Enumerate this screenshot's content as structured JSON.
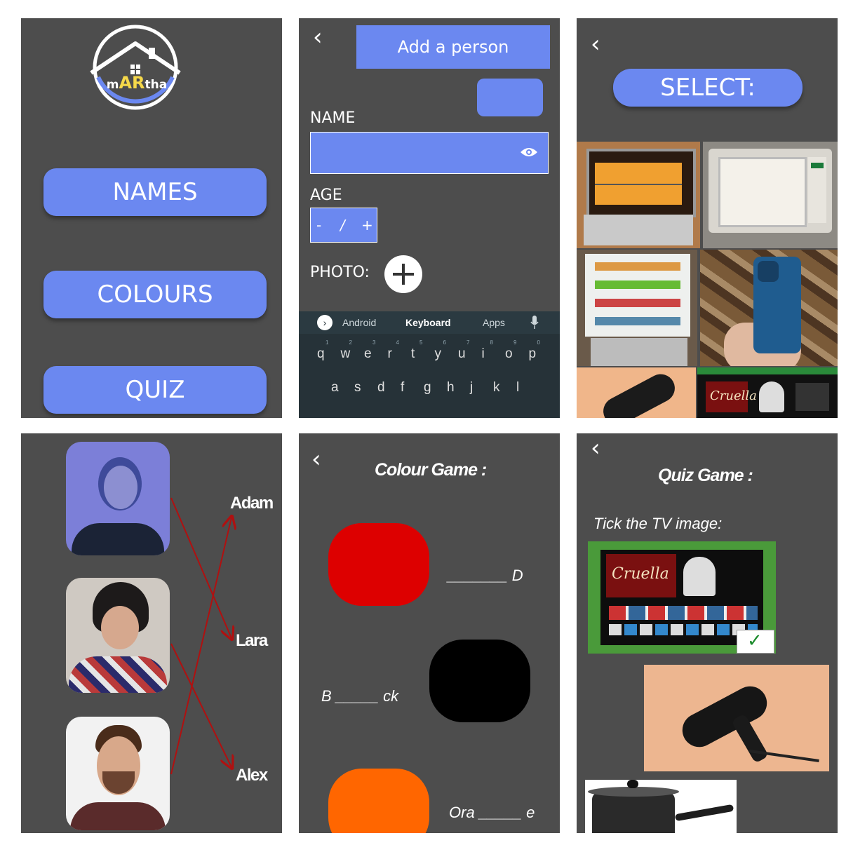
{
  "home": {
    "logo_text_pre": "m",
    "logo_text_ar": "AR",
    "logo_text_post": "tha",
    "buttons": [
      "NAMES",
      "COLOURS",
      "QUIZ"
    ]
  },
  "add_person": {
    "header": "Add a person",
    "name_label": "NAME",
    "age_label": "AGE",
    "stepper_minus": "-",
    "stepper_value": "/",
    "stepper_plus": "+",
    "photo_label": "PHOTO:",
    "keyboard": {
      "tabs": [
        "Android",
        "Keyboard",
        "Apps"
      ],
      "row1": [
        "q",
        "w",
        "e",
        "r",
        "t",
        "y",
        "u",
        "i",
        "o",
        "p"
      ],
      "row1_hints": [
        "1",
        "2",
        "3",
        "4",
        "5",
        "6",
        "7",
        "8",
        "9",
        "0"
      ],
      "row2": [
        "a",
        "s",
        "d",
        "f",
        "g",
        "h",
        "j",
        "k",
        "l"
      ]
    }
  },
  "select": {
    "header": "SELECT:",
    "images": [
      "oven-photo",
      "microwave-photo",
      "fridge-photo",
      "phone-photo",
      "hairdryer-photo",
      "tv-photo"
    ],
    "tv_banner": "Cruella"
  },
  "names_game": {
    "names": [
      "Adam",
      "Lara",
      "Alex"
    ]
  },
  "colour_game": {
    "title": "Colour Game :",
    "items": [
      {
        "color": "#dd0000",
        "prompt_blank": "_______",
        "prompt_tail": "D"
      },
      {
        "color": "#000000",
        "prompt_head": "B",
        "prompt_blank": "_____",
        "prompt_tail": "ck"
      },
      {
        "color": "#ff6600",
        "prompt_head": "Ora",
        "prompt_blank": "_____",
        "prompt_tail": "e"
      }
    ]
  },
  "quiz_game": {
    "title": "Quiz Game :",
    "instruction": "Tick the TV image:",
    "tv_banner": "Cruella",
    "check": "✓"
  },
  "colors": {
    "panel_bg": "#4d4d4d",
    "accent_blue": "#6b88f0",
    "arrow_red": "#b01010"
  }
}
